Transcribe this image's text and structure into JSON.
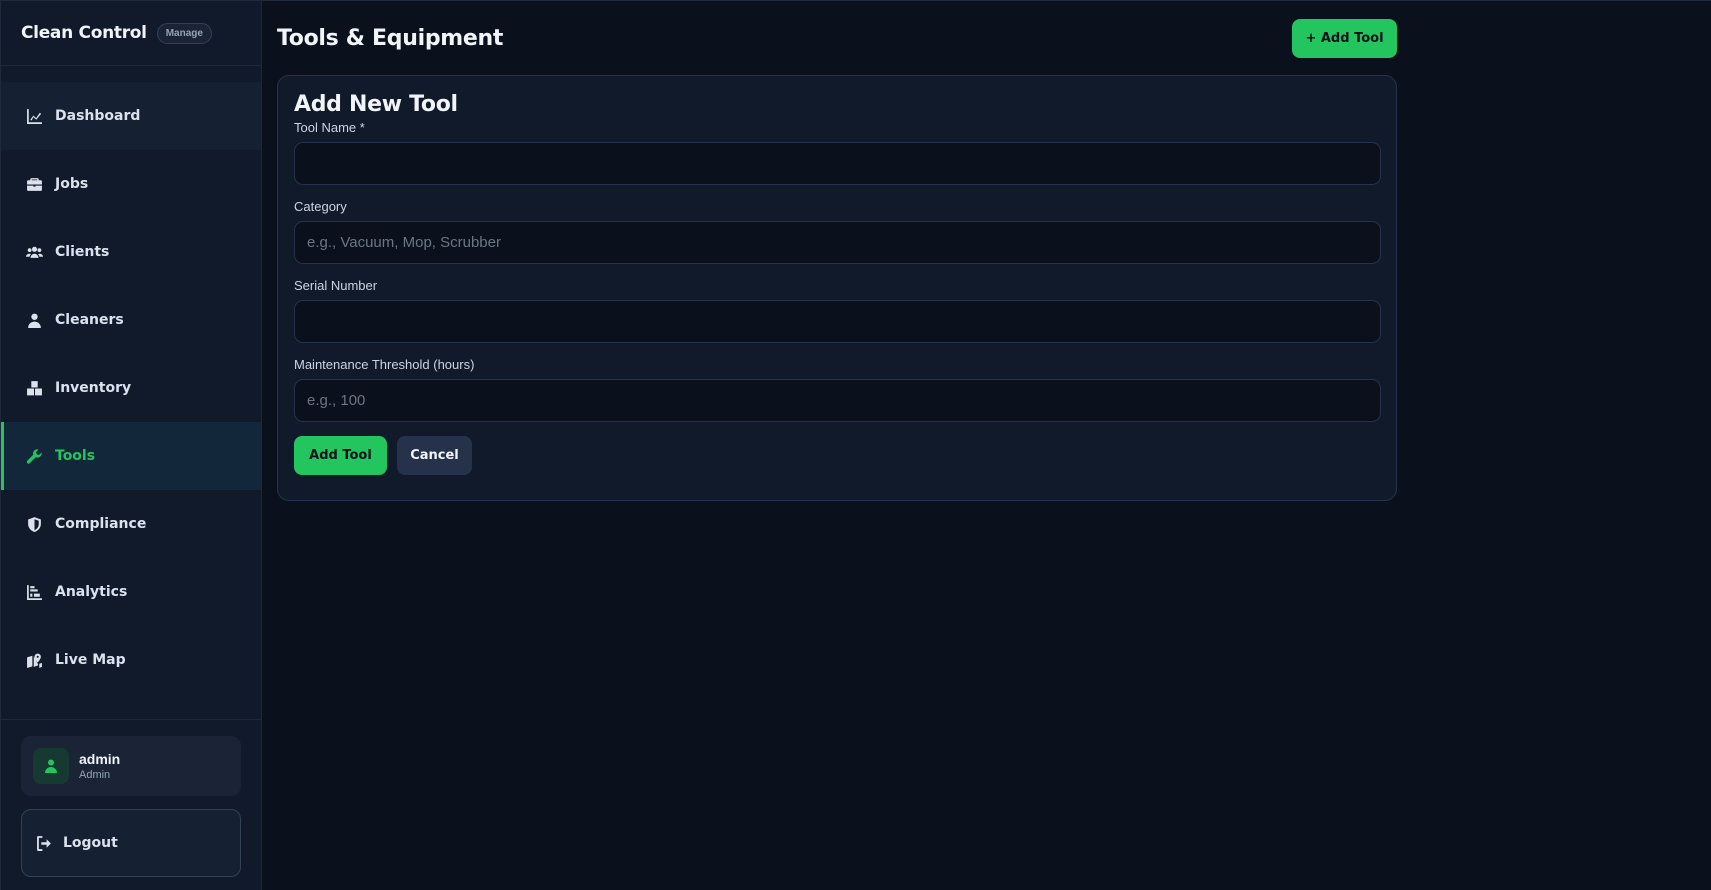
{
  "brand": {
    "title": "Clean Control",
    "badge": "Manage"
  },
  "sidebar": {
    "items": [
      {
        "label": "Dashboard",
        "icon": "chart-line-icon"
      },
      {
        "label": "Jobs",
        "icon": "briefcase-icon"
      },
      {
        "label": "Clients",
        "icon": "users-icon"
      },
      {
        "label": "Cleaners",
        "icon": "user-icon"
      },
      {
        "label": "Inventory",
        "icon": "boxes-icon"
      },
      {
        "label": "Tools",
        "icon": "wrench-icon",
        "active": true
      },
      {
        "label": "Compliance",
        "icon": "shield-icon"
      },
      {
        "label": "Analytics",
        "icon": "bar-chart-icon"
      },
      {
        "label": "Live Map",
        "icon": "map-icon"
      }
    ]
  },
  "user": {
    "name": "admin",
    "role": "Admin"
  },
  "logout_label": "Logout",
  "header": {
    "title": "Tools & Equipment",
    "add_button": "+ Add Tool"
  },
  "form": {
    "title": "Add New Tool",
    "tool_name": {
      "label": "Tool Name *",
      "value": "",
      "placeholder": ""
    },
    "category": {
      "label": "Category",
      "value": "",
      "placeholder": "e.g., Vacuum, Mop, Scrubber"
    },
    "serial_number": {
      "label": "Serial Number",
      "value": "",
      "placeholder": ""
    },
    "maintenance": {
      "label": "Maintenance Threshold (hours)",
      "value": "",
      "placeholder": "e.g., 100"
    },
    "submit_label": "Add Tool",
    "cancel_label": "Cancel"
  },
  "colors": {
    "accent": "#22c55e",
    "background": "#0b111c",
    "sidebar": "#111a2b"
  }
}
